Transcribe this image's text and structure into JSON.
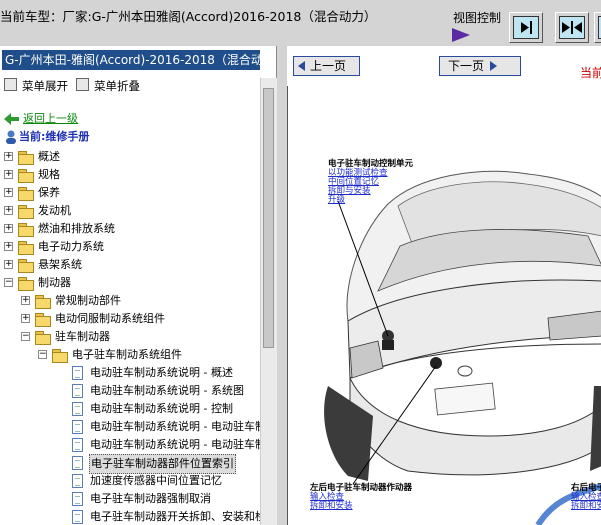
{
  "header": {
    "vehicle_label": "当前车型：厂家:G-广州本田雅阁(Accord)2016-2018（混合动力）",
    "view_control_label": "视图控制"
  },
  "sidebar": {
    "model_title": "G-广州本田-雅阁(Accord)-2016-2018（混合动力",
    "expand_label": "菜单展开",
    "collapse_label": "菜单折叠",
    "back_label": "返回上一级",
    "current_label": "当前:维修手册",
    "top_items": [
      "概述",
      "规格",
      "保养",
      "发动机",
      "燃油和排放系统",
      "电子动力系统",
      "悬架系统",
      "制动器"
    ],
    "brake_children": [
      "常规制动部件",
      "电动伺服制动系统组件",
      "驻车制动器"
    ],
    "parking_children": [
      "电子驻车制动系统组件"
    ],
    "docs": [
      "电动驻车制动系统说明 - 概述",
      "电动驻车制动系统说明 - 系统图",
      "电动驻车制动系统说明 - 控制",
      "电动驻车制动系统说明 - 电动驻车制",
      "电动驻车制动系统说明 - 电动驻车制",
      "电子驻车制动器部件位置索引",
      "加速度传感器中间位置记忆",
      "电子驻车制动器强制取消",
      "电子驻车制动器开关拆卸、安装和检"
    ],
    "selected_doc_index": 5
  },
  "content": {
    "prev_label": "上一页",
    "next_label": "下一页",
    "current_label": "当前文",
    "callout_top": {
      "title": "电子驻车制动控制单元",
      "links": [
        "以功能测试检查",
        "中间位置记忆",
        "拆卸与安装",
        "升级"
      ]
    },
    "callout_left": {
      "title": "左后电子驻车制动器作动器",
      "links": [
        "输入检查",
        "拆卸和安装"
      ]
    },
    "callout_right": {
      "title": "右后电子驻车",
      "links": [
        "输入检查",
        "拆卸和安装"
      ]
    }
  }
}
